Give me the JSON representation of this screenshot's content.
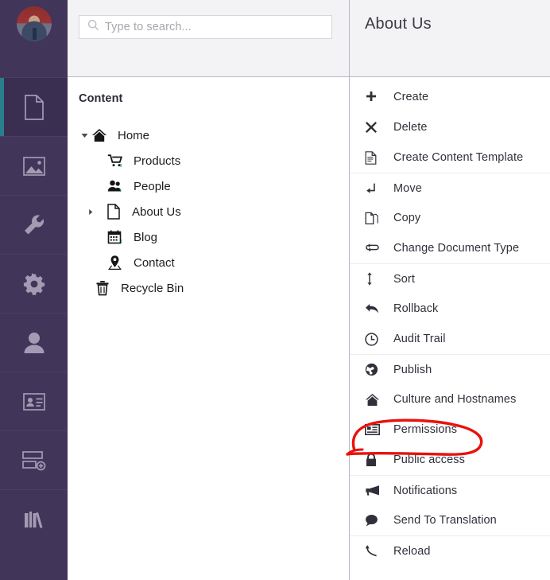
{
  "colors": {
    "rail_bg": "#413559",
    "rail_active_bg": "#3b2f51",
    "rail_accent": "#2a7f8e",
    "header_bg": "#f3f3f5",
    "annotation": "#e8120d",
    "text": "#30303a"
  },
  "rail": {
    "avatar": "user-avatar",
    "items": [
      {
        "name": "content",
        "icon": "document-icon",
        "active": true
      },
      {
        "name": "media",
        "icon": "image-icon",
        "active": false
      },
      {
        "name": "settings",
        "icon": "wrench-icon",
        "active": false
      },
      {
        "name": "developer",
        "icon": "gear-icon",
        "active": false
      },
      {
        "name": "users",
        "icon": "user-icon",
        "active": false
      },
      {
        "name": "members",
        "icon": "id-card-icon",
        "active": false
      },
      {
        "name": "forms",
        "icon": "form-icon",
        "active": false
      },
      {
        "name": "packages",
        "icon": "books-icon",
        "active": false
      }
    ]
  },
  "search": {
    "placeholder": "Type to search...",
    "value": "",
    "icon": "search-icon"
  },
  "tree": {
    "title": "Content",
    "nodes": [
      {
        "label": "Home",
        "icon": "home-icon",
        "depth": 0,
        "caret": "expanded"
      },
      {
        "label": "Products",
        "icon": "cart-icon",
        "depth": 1,
        "caret": "none"
      },
      {
        "label": "People",
        "icon": "people-icon",
        "depth": 1,
        "caret": "none"
      },
      {
        "label": "About Us",
        "icon": "document-icon",
        "depth": 1,
        "caret": "collapsed"
      },
      {
        "label": "Blog",
        "icon": "calendar-icon",
        "depth": 1,
        "caret": "none"
      },
      {
        "label": "Contact",
        "icon": "map-pin-icon",
        "depth": 1,
        "caret": "none"
      },
      {
        "label": "Recycle Bin",
        "icon": "trash-icon",
        "depth": 0,
        "caret": "none"
      }
    ]
  },
  "actions": {
    "title": "About Us",
    "items": [
      {
        "label": "Create",
        "icon": "plus-icon",
        "separator": false
      },
      {
        "label": "Delete",
        "icon": "x-icon",
        "separator": false
      },
      {
        "label": "Create Content Template",
        "icon": "document-template-icon",
        "separator": false
      },
      {
        "label": "Move",
        "icon": "move-icon",
        "separator": true
      },
      {
        "label": "Copy",
        "icon": "copy-icon",
        "separator": false
      },
      {
        "label": "Change Document Type",
        "icon": "swap-icon",
        "separator": false
      },
      {
        "label": "Sort",
        "icon": "sort-icon",
        "separator": true
      },
      {
        "label": "Rollback",
        "icon": "undo-arrow-icon",
        "separator": false
      },
      {
        "label": "Audit Trail",
        "icon": "clock-icon",
        "separator": false
      },
      {
        "label": "Publish",
        "icon": "globe-icon",
        "separator": true
      },
      {
        "label": "Culture and Hostnames",
        "icon": "home-icon",
        "separator": false
      },
      {
        "label": "Permissions",
        "icon": "permissions-card-icon",
        "separator": false
      },
      {
        "label": "Public access",
        "icon": "lock-icon",
        "separator": false
      },
      {
        "label": "Notifications",
        "icon": "megaphone-icon",
        "separator": true
      },
      {
        "label": "Send To Translation",
        "icon": "speech-bubble-icon",
        "separator": false
      },
      {
        "label": "Reload",
        "icon": "reload-icon",
        "separator": true
      }
    ],
    "highlighted_item": "Permissions"
  }
}
